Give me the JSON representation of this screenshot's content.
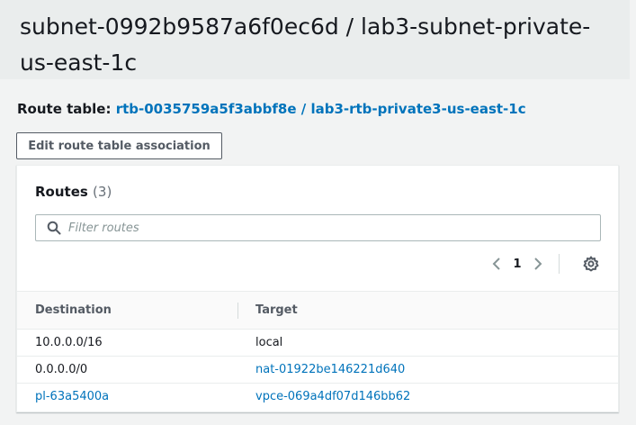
{
  "page": {
    "title_line1": "subnet-0992b9587a6f0ec6d / lab3-subnet-private-",
    "title_line2": "us-east-1c"
  },
  "route_table": {
    "label": "Route table:",
    "link": "rtb-0035759a5f3abbf8e / lab3-rtb-private3-us-east-1c"
  },
  "edit_button_label": "Edit route table association",
  "routes_panel": {
    "title": "Routes",
    "count": "(3)",
    "filter_placeholder": "Filter routes",
    "current_page": "1",
    "columns": [
      "Destination",
      "Target"
    ],
    "rows": [
      {
        "destination": "10.0.0.0/16",
        "target": "local",
        "destination_link": false,
        "target_link": false
      },
      {
        "destination": "0.0.0.0/0",
        "target": "nat-01922be146221d640",
        "destination_link": false,
        "target_link": true
      },
      {
        "destination": "pl-63a5400a",
        "target": "vpce-069a4df07d146bb62",
        "destination_link": true,
        "target_link": true
      }
    ]
  },
  "colors": {
    "link": "#0073bb",
    "text": "#16191f",
    "muted": "#687078",
    "background": "#f2f3f3"
  },
  "icons": {
    "search": "search-icon",
    "prev": "chevron-left-icon",
    "next": "chevron-right-icon",
    "settings": "gear-icon"
  }
}
